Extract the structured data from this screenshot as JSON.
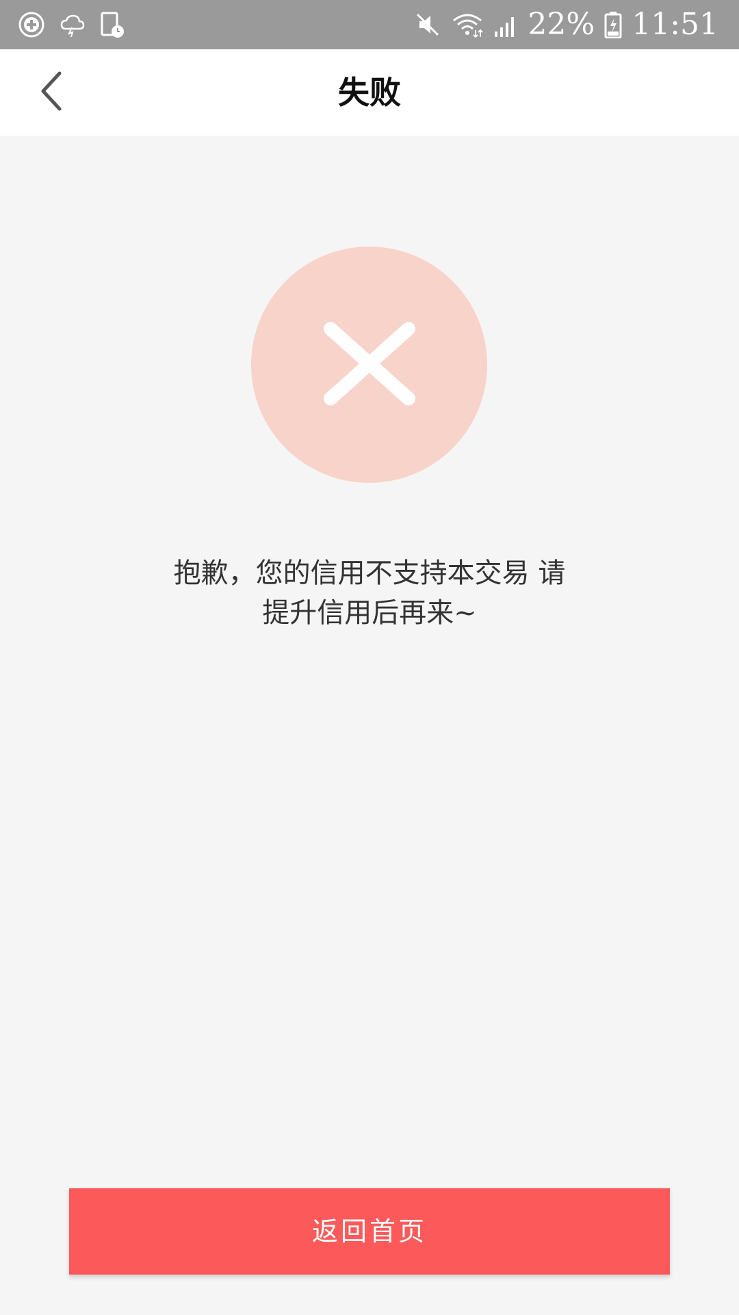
{
  "status_bar": {
    "battery_percent": "22%",
    "time": "11:51",
    "icons": [
      "add-circle-icon",
      "cloud-icon",
      "screen-clock-icon",
      "mute-icon",
      "wifi-icon",
      "signal-icon",
      "battery-icon"
    ]
  },
  "nav": {
    "title": "失败",
    "back_icon": "chevron-left-icon"
  },
  "result": {
    "icon": "close-icon",
    "circle_color": "#f8d3c9",
    "message_line1": "抱歉，您的信用不支持本交易 请",
    "message_line2": "提升信用后再来~"
  },
  "actions": {
    "home_button_label": "返回首页",
    "home_button_color": "#fc5a5a"
  }
}
